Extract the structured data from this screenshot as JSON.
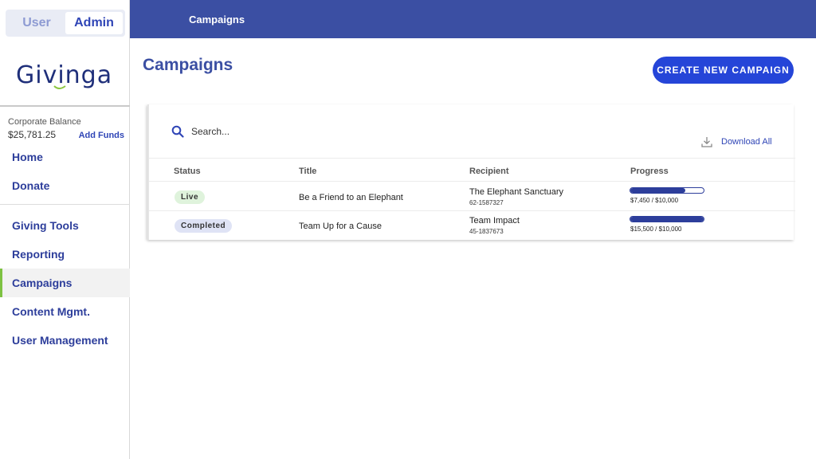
{
  "sidebar": {
    "role_toggle": {
      "user": "User",
      "admin": "Admin"
    },
    "logo": "Givinga",
    "balance": {
      "label": "Corporate Balance",
      "value": "$25,781.25",
      "add_funds": "Add Funds"
    },
    "nav_primary": [
      {
        "label": "Home"
      },
      {
        "label": "Donate"
      }
    ],
    "nav_secondary": [
      {
        "label": "Giving Tools"
      },
      {
        "label": "Reporting"
      },
      {
        "label": "Campaigns",
        "active": true
      },
      {
        "label": "Content Mgmt."
      },
      {
        "label": "User Management"
      }
    ]
  },
  "topbar": {
    "title": "Campaigns"
  },
  "main": {
    "title": "Campaigns",
    "create_button": "CREATE NEW CAMPAIGN",
    "search": {
      "placeholder": "Search..."
    },
    "download_all": "Download All",
    "columns": [
      "Status",
      "Title",
      "Recipient",
      "Progress"
    ],
    "rows": [
      {
        "status": "Live",
        "title": "Be a Friend to an Elephant",
        "recipient": "The Elephant Sanctuary",
        "ein": "62-1587327",
        "progress_text": "$7,450 / $10,000",
        "progress_fraction": 0.745
      },
      {
        "status": "Completed",
        "title": "Team Up for a Cause",
        "recipient": "Team Impact",
        "ein": "45-1837673",
        "progress_text": "$15,500 / $10,000",
        "progress_fraction": 1.0
      }
    ]
  },
  "icons": {
    "search": "search-icon",
    "download": "download-icon"
  },
  "colors": {
    "brand": "#3b4fa3",
    "accent": "#2545d8",
    "active_indicator": "#7ec242"
  }
}
